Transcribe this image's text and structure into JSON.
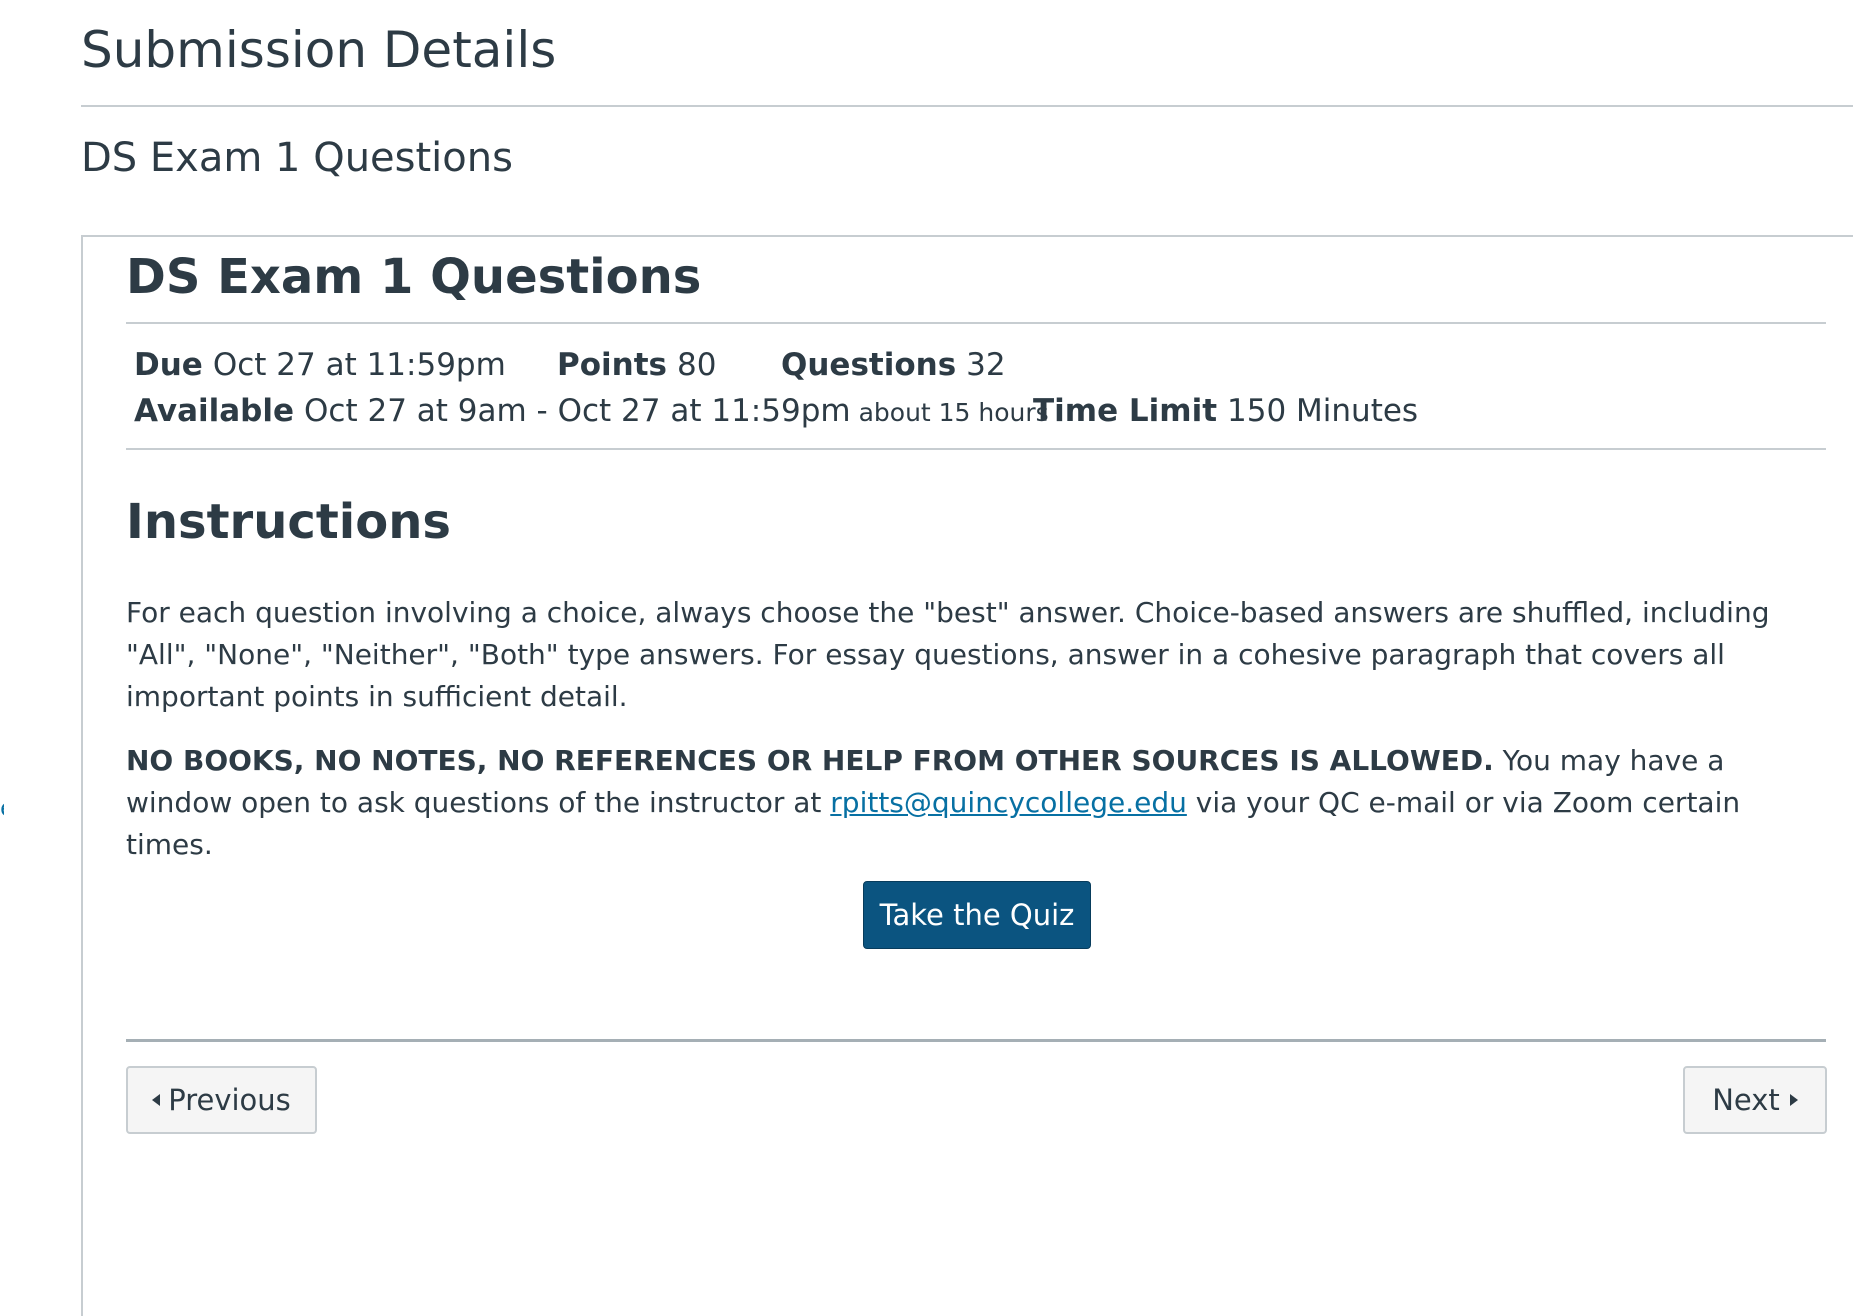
{
  "header": {
    "page_title": "Submission Details",
    "assignment_name": "DS Exam 1 Questions",
    "left_link_fragment": "e"
  },
  "quiz": {
    "title": "DS Exam 1 Questions",
    "details": {
      "due_label": "Due",
      "due_value": "Oct 27 at 11:59pm",
      "points_label": "Points",
      "points_value": "80",
      "questions_label": "Questions",
      "questions_value": "32",
      "available_label": "Available",
      "available_value": "Oct 27 at 9am - Oct 27 at 11:59pm",
      "available_duration": "about 15 hours",
      "time_limit_label": "Time Limit",
      "time_limit_value": "150 Minutes"
    },
    "instructions": {
      "heading": "Instructions",
      "paragraph_1": "For each question involving a choice, always choose the \"best\" answer.  Choice-based answers are shuffled, including \"All\", \"None\", \"Neither\", \"Both\" type answers.  For essay questions, answer in a cohesive paragraph that covers all important points in sufficient detail.",
      "paragraph_2_bold": "NO BOOKS, NO NOTES, NO REFERENCES OR HELP FROM OTHER SOURCES IS ALLOWED.",
      "paragraph_2_before_link": " You may have a window open to ask questions of the instructor at ",
      "email_link": "rpitts@quincycollege.edu",
      "paragraph_2_after_link": " via your QC e-mail or via Zoom certain times."
    },
    "take_quiz_label": "Take the Quiz"
  },
  "navigation": {
    "previous_label": "Previous",
    "next_label": "Next",
    "previous_icon": "caret-left-icon",
    "next_icon": "caret-right-icon"
  },
  "colors": {
    "text": "#2d3b45",
    "link": "#0770a3",
    "primary_button": "#0b5480",
    "divider": "#c7cdd1"
  }
}
